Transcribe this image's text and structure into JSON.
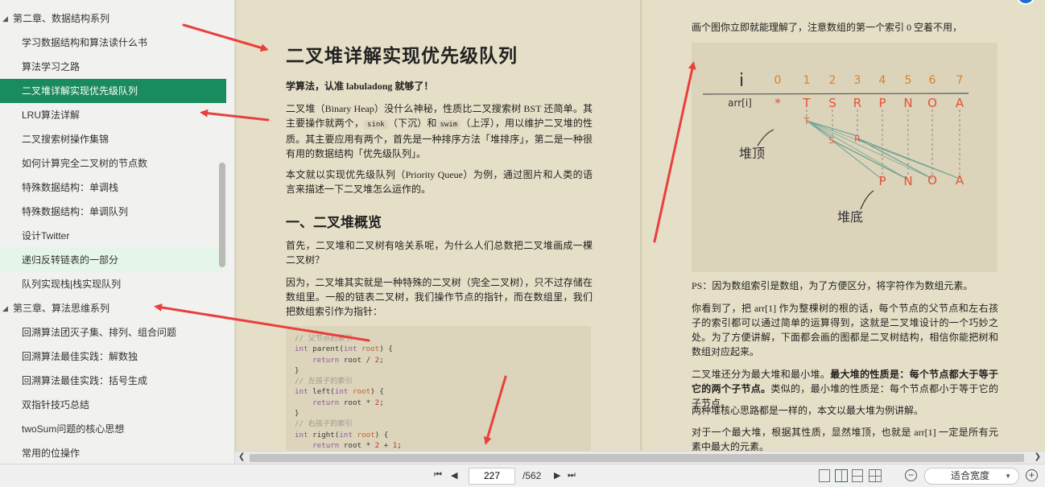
{
  "sidebar": {
    "items": [
      {
        "label": "第二章、数据结构系列",
        "type": "chapter",
        "state": ""
      },
      {
        "label": "学习数据结构和算法读什么书",
        "type": "leaf",
        "state": ""
      },
      {
        "label": "算法学习之路",
        "type": "leaf",
        "state": ""
      },
      {
        "label": "二叉堆详解实现优先级队列",
        "type": "leaf",
        "state": "active"
      },
      {
        "label": "LRU算法详解",
        "type": "leaf",
        "state": ""
      },
      {
        "label": "二叉搜索树操作集锦",
        "type": "leaf",
        "state": ""
      },
      {
        "label": "如何计算完全二叉树的节点数",
        "type": "leaf",
        "state": ""
      },
      {
        "label": "特殊数据结构：单调栈",
        "type": "leaf",
        "state": ""
      },
      {
        "label": "特殊数据结构：单调队列",
        "type": "leaf",
        "state": ""
      },
      {
        "label": "设计Twitter",
        "type": "leaf",
        "state": ""
      },
      {
        "label": "递归反转链表的一部分",
        "type": "leaf",
        "state": "hover"
      },
      {
        "label": "队列实现栈|栈实现队列",
        "type": "leaf",
        "state": ""
      },
      {
        "label": "第三章、算法思维系列",
        "type": "chapter",
        "state": ""
      },
      {
        "label": "回溯算法团灭子集、排列、组合问题",
        "type": "leaf",
        "state": ""
      },
      {
        "label": "回溯算法最佳实践：解数独",
        "type": "leaf",
        "state": ""
      },
      {
        "label": "回溯算法最佳实践：括号生成",
        "type": "leaf",
        "state": ""
      },
      {
        "label": "双指针技巧总结",
        "type": "leaf",
        "state": ""
      },
      {
        "label": "twoSum问题的核心思想",
        "type": "leaf",
        "state": ""
      },
      {
        "label": "常用的位操作",
        "type": "leaf",
        "state": ""
      }
    ]
  },
  "left_page": {
    "title": "二叉堆详解实现优先级队列",
    "slogan": "学算法，认准 labuladong 就够了！",
    "p1_a": "二叉堆（Binary Heap）没什么神秘，性质比二叉搜索树 BST 还简单。其主要操作就两个，",
    "p1_code1": "sink",
    "p1_b": "（下沉）和",
    "p1_code2": "swim",
    "p1_c": "（上浮），用以维护二叉堆的性质。其主要应用有两个，首先是一种排序方法「堆排序」，第二是一种很有用的数据结构「优先级队列」。",
    "p2": "本文就以实现优先级队列（Priority Queue）为例，通过图片和人类的语言来描述一下二叉堆怎么运作的。",
    "h2": "一、二叉堆概览",
    "p3": "首先，二叉堆和二叉树有啥关系呢，为什么人们总数把二叉堆画成一棵二叉树？",
    "p4": "因为，二叉堆其实就是一种特殊的二叉树（完全二叉树），只不过存储在数组里。一般的链表二叉树，我们操作节点的指针，而在数组里，我们把数组索引作为指针：",
    "code": {
      "c1": "// 父节点的索引",
      "c2": "// 左孩子的索引",
      "c3": "// 右孩子的索引",
      "kw": "int",
      "fn1": "parent",
      "fn2": "left",
      "fn3": "right",
      "param": "root",
      "ret": "return",
      "num2": "2",
      "num1": "1"
    }
  },
  "right_page": {
    "p0": "画个图你立即就能理解了，注意数组的第一个索引 0 空着不用，",
    "figure": {
      "i_label": "i",
      "indices": [
        "0",
        "1",
        "2",
        "3",
        "4",
        "5",
        "6",
        "7"
      ],
      "arr_label": "arr[i]",
      "values": [
        "*",
        "T",
        "S",
        "R",
        "P",
        "N",
        "O",
        "A"
      ],
      "top_label": "堆顶",
      "bottom_label": "堆底"
    },
    "ps": "PS：因为数组索引是数组，为了方便区分，将字符作为数组元素。",
    "p1": "你看到了，把 arr[1] 作为整棵树的根的话，每个节点的父节点和左右孩子的索引都可以通过简单的运算得到，这就是二叉堆设计的一个巧妙之处。为了方便讲解，下面都会画的图都是二叉树结构，相信你能把树和数组对应起来。",
    "p2_a": "二叉堆还分为最大堆和最小堆。",
    "p2_b": "最大堆的性质是：每个节点都大于等于它的两个子节点。",
    "p2_c": "类似的，最小堆的性质是：每个节点都小于等于它的子节点。",
    "p3": "两种堆核心思路都是一样的，本文以最大堆为例讲解。",
    "p4": "对于一个最大堆，根据其性质，显然堆顶，也就是 arr[1] 一定是所有元素中最大的元素。"
  },
  "toolbar": {
    "current_page": "227",
    "total_pages": "/562",
    "zoom_mode": "适合宽度"
  },
  "colors": {
    "accent_active": "#1a8a5f",
    "annotation_arrow": "#e8403c"
  }
}
